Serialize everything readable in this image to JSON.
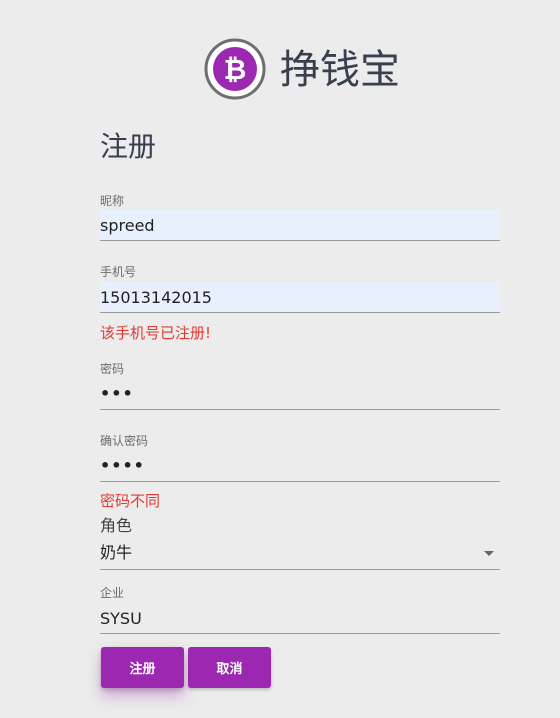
{
  "header": {
    "app_title": "挣钱宝",
    "logo_icon": "bitcoin-icon",
    "logo_glyph": "₿"
  },
  "form": {
    "title": "注册",
    "nickname": {
      "label": "昵称",
      "value": "spreed"
    },
    "phone": {
      "label": "手机号",
      "value": "15013142015",
      "error": "该手机号已注册!"
    },
    "password": {
      "label": "密码",
      "value": "•••"
    },
    "confirm_password": {
      "label": "确认密码",
      "value": "••••",
      "error": "密码不同"
    },
    "role": {
      "label": "角色",
      "value": "奶牛"
    },
    "company": {
      "label": "企业",
      "value": "SYSU"
    },
    "buttons": {
      "register": "注册",
      "cancel": "取消"
    }
  },
  "colors": {
    "accent": "#9c27b0",
    "error": "#e53935",
    "background": "#ececec",
    "autofill": "#e8f0fe"
  }
}
